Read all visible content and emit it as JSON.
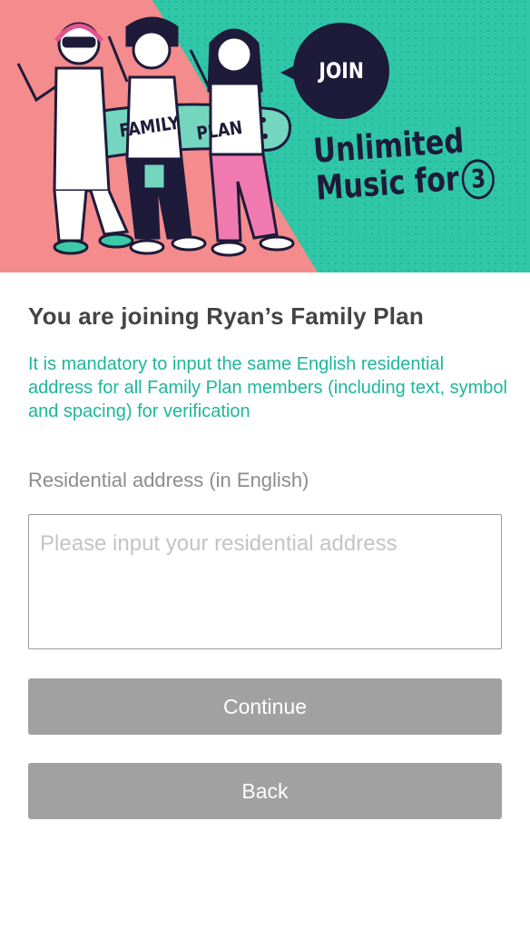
{
  "banner": {
    "join_label": "JOIN",
    "headline_line1": "Unlimited",
    "headline_line2": "Music for",
    "headline_number": "3",
    "board_text_left": "FAMILY",
    "board_text_right": "PLAN",
    "colors": {
      "left_bg": "#f48b8c",
      "right_bg": "#2fc7a7",
      "ink": "#1e1b3a"
    }
  },
  "page": {
    "title": "You are joining Ryan’s Family Plan",
    "notice": "It is mandatory to input the same English residential address for all Family Plan members (including text, symbol and spacing) for verification"
  },
  "form": {
    "address_label": "Residential address (in English)",
    "address_placeholder": "Please input your residential address",
    "address_value": ""
  },
  "actions": {
    "continue_label": "Continue",
    "back_label": "Back"
  },
  "colors": {
    "accent": "#1db69c",
    "button_disabled": "#a1a1a1"
  }
}
